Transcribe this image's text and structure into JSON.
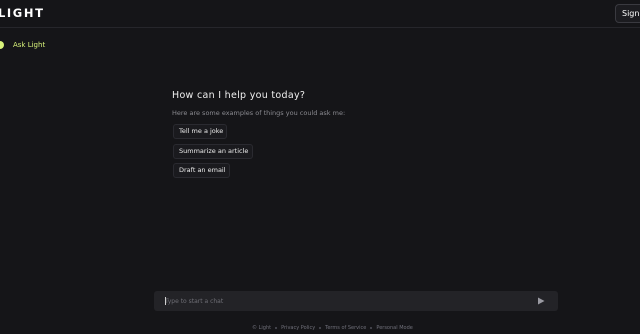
{
  "header": {
    "logo_text": "LIGHT",
    "sign_in_label": "Sign in"
  },
  "sidebar": {
    "items": [
      {
        "label": "Ask Light"
      }
    ]
  },
  "main": {
    "greeting": "How can I help you today?",
    "subtext": "Here are some examples of things you could ask me:",
    "suggestions": [
      {
        "label": "Tell me a joke"
      },
      {
        "label": "Summarize an article"
      },
      {
        "label": "Draft an email"
      }
    ]
  },
  "chat": {
    "placeholder": "Type to start a chat",
    "send_icon": "send-icon"
  },
  "footer": {
    "links": [
      {
        "label": "© Light"
      },
      {
        "label": "Privacy Policy"
      },
      {
        "label": "Terms of Service"
      },
      {
        "label": "Personal Mode"
      }
    ]
  },
  "colors": {
    "background": "#151518",
    "accent": "#d8f27a",
    "input_background": "#232327"
  }
}
